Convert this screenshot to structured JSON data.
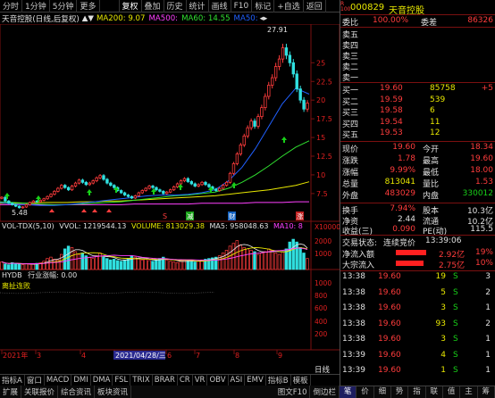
{
  "toolbar": {
    "items": [
      "分时",
      "1分钟",
      "5分钟",
      "更多",
      "",
      "复权",
      "叠加",
      "历史",
      "统计",
      "画线",
      "F10",
      "标记",
      "+自选",
      "返回"
    ]
  },
  "title": {
    "stock": "天音控股(日线,后复权)",
    "ma200": "MA200: 9.07",
    "ma500": "MA500:",
    "ma60": "MA60: 14.55",
    "ma50": "MA50:"
  },
  "chart_data": {
    "type": "candlestick",
    "title": "天音控股(日线,后复权)",
    "ylim": [
      4.5,
      28.5
    ],
    "y_ticks": [
      25.0,
      22.5,
      20.0,
      17.5,
      15.0,
      12.5,
      10.0,
      7.5
    ],
    "annotations": {
      "high": "27.91",
      "low": "5.48"
    },
    "x_ticks": [
      "2021年",
      "3",
      "4",
      "2021/04/28/三",
      "6",
      "7",
      "8",
      "9"
    ],
    "series": [
      {
        "name": "MA200",
        "color": "#e8e800",
        "values": [
          6.2,
          6.2,
          6.2,
          6.3,
          6.3,
          6.3,
          6.4,
          6.4,
          6.5,
          6.5,
          6.6,
          6.7,
          6.8,
          6.9,
          7.0,
          7.1,
          7.2,
          7.4,
          7.6,
          7.8,
          8.0,
          8.3,
          8.6,
          9.07
        ]
      },
      {
        "name": "MA500",
        "color": "#ff40ff",
        "values": [
          6.0,
          6.0,
          6.0,
          6.0,
          6.0,
          6.0,
          6.0,
          6.0,
          6.0,
          6.0,
          6.1,
          6.1,
          6.1,
          6.1,
          6.1,
          6.2,
          6.2,
          6.2,
          6.2,
          6.3,
          6.3,
          6.3,
          6.4,
          6.4
        ]
      },
      {
        "name": "MA60",
        "color": "#30e030",
        "values": [
          6.4,
          6.3,
          6.2,
          6.1,
          6.0,
          6.0,
          6.1,
          6.2,
          6.3,
          6.4,
          6.6,
          6.8,
          7.0,
          7.2,
          7.3,
          7.5,
          7.7,
          8.2,
          9.0,
          10.0,
          11.2,
          12.5,
          13.7,
          14.55
        ]
      },
      {
        "name": "MA50",
        "color": "#2060ff",
        "values": [
          6.3,
          6.1,
          6.0,
          5.9,
          5.9,
          6.0,
          6.2,
          6.4,
          6.6,
          6.8,
          7.0,
          7.2,
          7.3,
          7.3,
          7.4,
          7.6,
          8.0,
          9.2,
          11.0,
          13.5,
          16.5,
          19.5,
          21.6,
          20.8
        ]
      }
    ],
    "closes": [
      7.0,
      6.5,
      6.2,
      6.0,
      5.8,
      5.6,
      5.7,
      6.0,
      6.3,
      6.5,
      6.4,
      6.6,
      6.8,
      7.1,
      7.4,
      7.8,
      8.2,
      8.6,
      8.3,
      8.0,
      8.5,
      8.9,
      9.3,
      9.0,
      8.7,
      8.9,
      9.2,
      9.6,
      9.9,
      9.4,
      8.9,
      8.6,
      8.3,
      7.9,
      7.6,
      7.3,
      7.1,
      6.9,
      7.2,
      7.6,
      7.9,
      8.2,
      8.5,
      8.3,
      8.0,
      7.8,
      7.5,
      7.7,
      8.0,
      8.4,
      8.8,
      9.2,
      9.5,
      9.1,
      8.8,
      8.5,
      8.7,
      9.0,
      8.7,
      8.4,
      8.1,
      7.9,
      8.2,
      8.6,
      9.0,
      10.2,
      11.5,
      12.8,
      14.0,
      15.2,
      16.3,
      17.2,
      16.5,
      17.8,
      19.0,
      20.5,
      22.0,
      23.0,
      24.5,
      25.5,
      27.0,
      26.0,
      25.0,
      23.5,
      21.5,
      20.0,
      18.8,
      19.6
    ]
  },
  "volume_panel": {
    "header": "VOL-TDX(5,10)",
    "vvol": "VVOL: 1219544.13",
    "volume": "VOLUME: 813029.38",
    "ma5": "MA5: 958048.63",
    "ma10": "MA10: 8",
    "y_ticks": [
      "X10000",
      "2000",
      "1000"
    ],
    "values": [
      0.55,
      0.4,
      0.35,
      0.5,
      0.45,
      0.4,
      0.35,
      0.42,
      0.38,
      0.4,
      0.45,
      0.5,
      0.6,
      0.8,
      0.9,
      0.75,
      0.7,
      1.1,
      1.5,
      1.7,
      1.6,
      1.3,
      1.1,
      1.2,
      1.0,
      0.9,
      0.8,
      1.0,
      1.2,
      0.9,
      0.8,
      0.7,
      0.75,
      0.65,
      0.6,
      0.7,
      0.8,
      1.0,
      0.9,
      0.8,
      0.7,
      0.75,
      0.65,
      0.6,
      0.7,
      0.8,
      0.9,
      0.7,
      0.6,
      0.55,
      0.5,
      0.6,
      0.7,
      0.65,
      0.6,
      0.55,
      0.6,
      0.7,
      0.75,
      0.8,
      0.85,
      0.9,
      1.0,
      1.2,
      1.4,
      1.7,
      1.9,
      2.1,
      1.8,
      1.6,
      1.5,
      1.4,
      1.3,
      1.1,
      1.2,
      1.3,
      1.5,
      1.4,
      1.2,
      1.1,
      1.3,
      1.5,
      2.0,
      2.2,
      2.0,
      1.6,
      1.2,
      0.8
    ]
  },
  "hydb_panel": {
    "header": "HYDB",
    "label": "行业涨幅: 0.00",
    "sub": "离扯连败",
    "y_ticks": [
      "1000",
      "800",
      "600",
      "400",
      "200"
    ]
  },
  "tabs_row1": [
    "指标A",
    "窗口",
    "MACD",
    "DMI",
    "DMA",
    "FSL",
    "TRIX",
    "BRAR",
    "CR",
    "VR",
    "OBV",
    "ASI",
    "EMV",
    "指标B",
    "模板"
  ],
  "tabs_row2": [
    "扩展",
    "关联报价",
    "综合资讯",
    "板块资讯"
  ],
  "day_label": "日线",
  "footer_tabs": [
    "图文F10",
    "倒边栏"
  ],
  "quote": {
    "code": "000829",
    "name": "天音控股",
    "weibi_label": "委比",
    "weibi": "100.00%",
    "weicha_label": "委差",
    "weicha": "86326",
    "asks": [
      {
        "label": "卖五",
        "price": "",
        "vol": ""
      },
      {
        "label": "卖四",
        "price": "",
        "vol": ""
      },
      {
        "label": "卖三",
        "price": "",
        "vol": ""
      },
      {
        "label": "卖二",
        "price": "",
        "vol": ""
      },
      {
        "label": "卖一",
        "price": "",
        "vol": ""
      }
    ],
    "bids": [
      {
        "label": "买一",
        "price": "19.60",
        "vol": "85758",
        "chg": "+5"
      },
      {
        "label": "买二",
        "price": "19.59",
        "vol": "539",
        "chg": ""
      },
      {
        "label": "买三",
        "price": "19.58",
        "vol": "6",
        "chg": ""
      },
      {
        "label": "买四",
        "price": "19.54",
        "vol": "11",
        "chg": ""
      },
      {
        "label": "买五",
        "price": "19.53",
        "vol": "12",
        "chg": ""
      }
    ],
    "stats": [
      {
        "l1": "现价",
        "v1": "19.60",
        "l2": "今开",
        "v2": "18.34"
      },
      {
        "l1": "涨跌",
        "v1": "1.78",
        "l2": "最高",
        "v2": "19.60"
      },
      {
        "l1": "涨幅",
        "v1": "9.99%",
        "l2": "最低",
        "v2": "18.00"
      },
      {
        "l1": "总量",
        "v1": "813041",
        "l2": "量比",
        "v2": "1.53"
      },
      {
        "l1": "外盘",
        "v1": "483029",
        "l2": "内盘",
        "v2": "330012"
      }
    ],
    "stats2": [
      {
        "l1": "换手",
        "v1": "7.94%",
        "l2": "股本",
        "v2": "10.3亿"
      },
      {
        "l1": "净资",
        "v1": "2.44",
        "l2": "流通",
        "v2": "10.2亿"
      },
      {
        "l1": "收益(三)",
        "v1": "0.090",
        "l2": "PE(动)",
        "v2": "115.5"
      }
    ],
    "trade_status_label": "交易状态:",
    "trade_status": "连续竞价",
    "trade_time": "13:39:06",
    "flows": [
      {
        "label": "净流入额",
        "value": "2.92亿",
        "pct": "19%",
        "fill": 0.6
      },
      {
        "label": "大宗流入",
        "value": "2.75亿",
        "pct": "10%",
        "fill": 0.55
      }
    ],
    "ticks": [
      {
        "t": "13:38",
        "p": "19.60",
        "v": "19",
        "s": "S",
        "n": "3"
      },
      {
        "t": "13:38",
        "p": "19.60",
        "v": "5",
        "s": "S",
        "n": "2"
      },
      {
        "t": "13:38",
        "p": "19.60",
        "v": "3",
        "s": "S",
        "n": "1"
      },
      {
        "t": "13:38",
        "p": "19.60",
        "v": "93",
        "s": "S",
        "n": "2"
      },
      {
        "t": "13:38",
        "p": "19.60",
        "v": "3",
        "s": "S",
        "n": "1"
      },
      {
        "t": "13:39",
        "p": "19.60",
        "v": "4",
        "s": "S",
        "n": "1"
      },
      {
        "t": "13:39",
        "p": "19.60",
        "v": "1",
        "s": "S",
        "n": "1"
      }
    ],
    "bottom_tabs": [
      "笔",
      "价",
      "细",
      "势",
      "指",
      "联",
      "值",
      "主",
      "筹"
    ]
  },
  "colors": {
    "up": "#ff3c3c",
    "down": "#18d018",
    "accent": "#e8e800"
  }
}
